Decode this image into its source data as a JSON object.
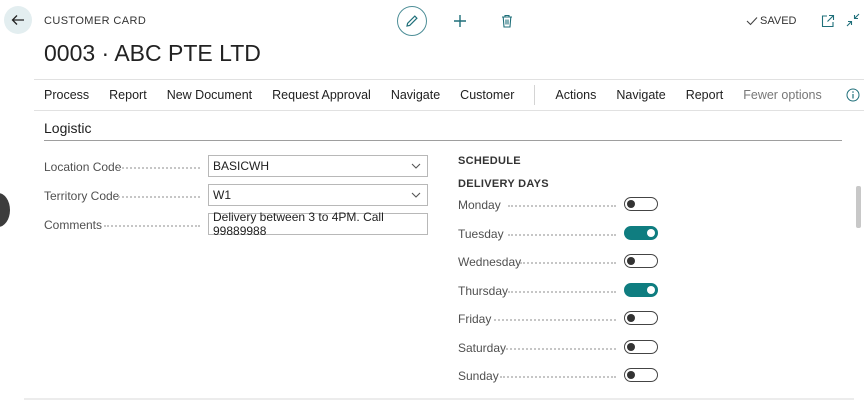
{
  "header": {
    "caption": "CUSTOMER CARD",
    "title": "0003 · ABC PTE LTD",
    "saved": "SAVED"
  },
  "actions": {
    "group1": [
      "Process",
      "Report",
      "New Document",
      "Request Approval",
      "Navigate",
      "Customer"
    ],
    "group2": [
      "Actions",
      "Navigate",
      "Report"
    ],
    "fewer": "Fewer options"
  },
  "section": {
    "title": "Logistic"
  },
  "fields": {
    "location": {
      "label": "Location Code",
      "value": "BASICWH"
    },
    "territory": {
      "label": "Territory Code",
      "value": "W1"
    },
    "comments": {
      "label": "Comments",
      "value": "Delivery between 3 to 4PM. Call 99889988"
    }
  },
  "schedule": {
    "heading": "SCHEDULE",
    "subheading": "DELIVERY DAYS",
    "days": [
      {
        "label": "Monday",
        "on": false
      },
      {
        "label": "Tuesday",
        "on": true
      },
      {
        "label": "Wednesday",
        "on": false
      },
      {
        "label": "Thursday",
        "on": true
      },
      {
        "label": "Friday",
        "on": false
      },
      {
        "label": "Saturday",
        "on": false
      },
      {
        "label": "Sunday",
        "on": false
      }
    ]
  },
  "colors": {
    "accent": "#0f7d80",
    "outline_accent": "#4d8e97"
  },
  "icons": [
    "back-arrow-icon",
    "pencil-icon",
    "plus-icon",
    "trash-icon",
    "checkmark-icon",
    "open-in-new-icon",
    "collapse-icon",
    "info-icon",
    "chevron-down-icon"
  ]
}
